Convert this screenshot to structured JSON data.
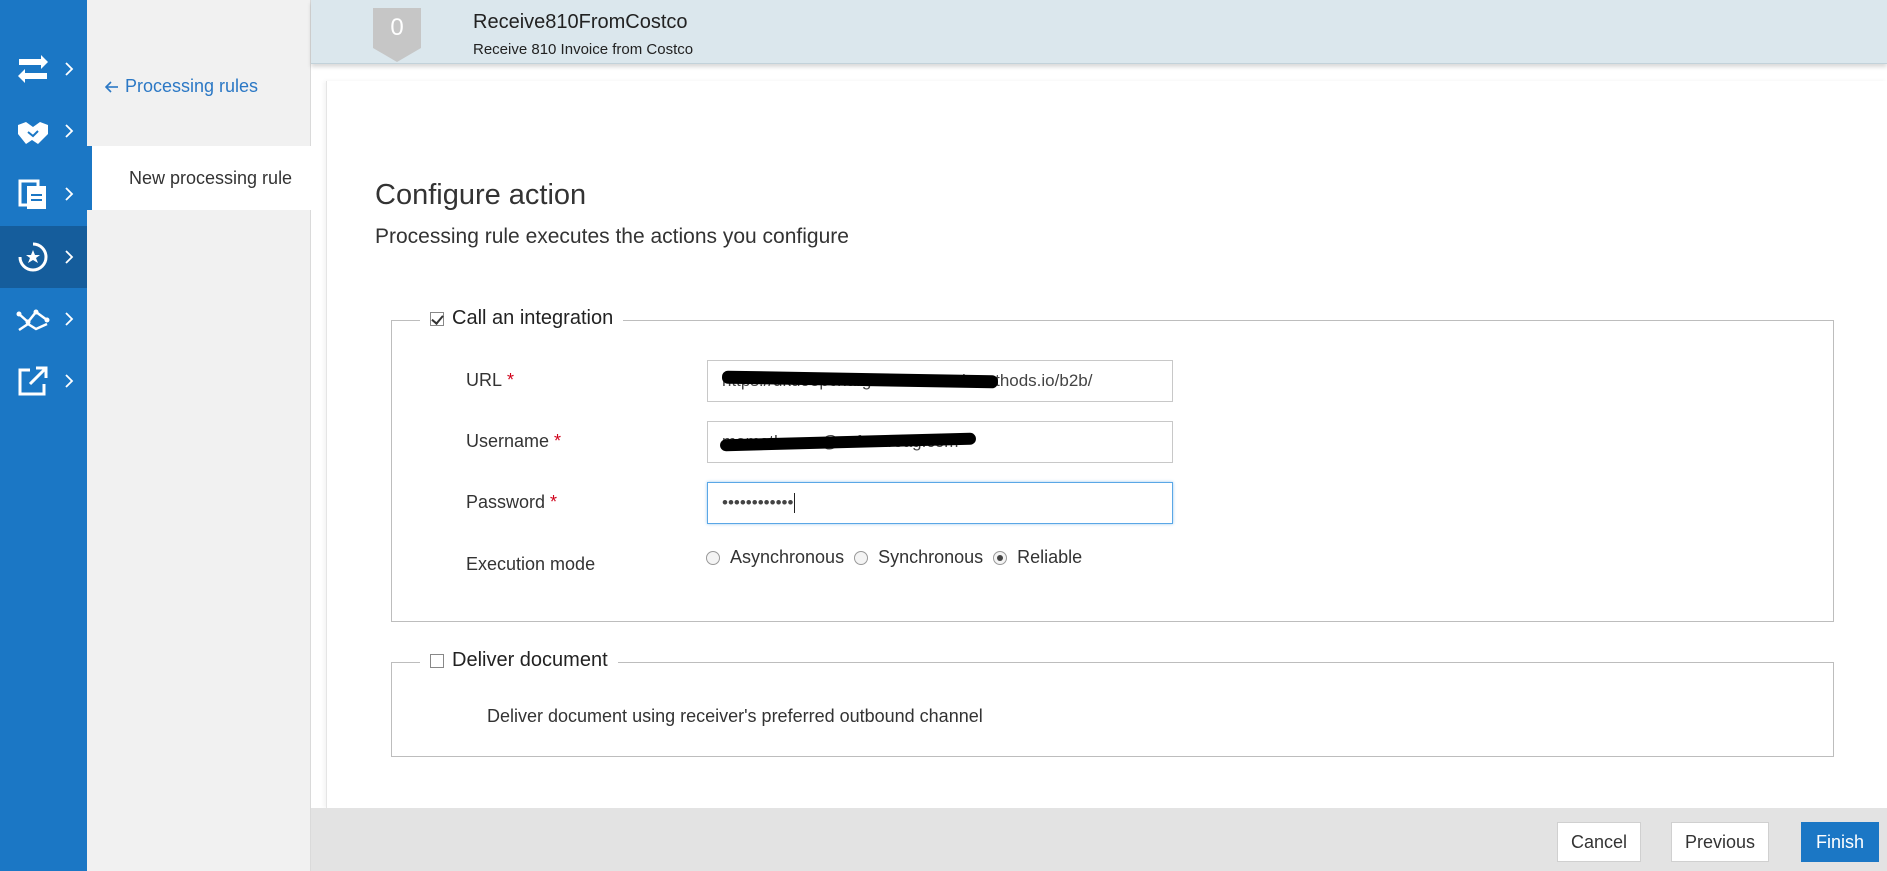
{
  "colors": {
    "rail": "#1b77c5",
    "rail_active": "#155d9c",
    "header_band": "#dbe7ed",
    "accent": "#1b77c5",
    "required": "#d0021b",
    "badge": "#c6c6c6"
  },
  "rail": {
    "items": [
      {
        "icon": "transfer-arrows-icon"
      },
      {
        "icon": "handshake-icon"
      },
      {
        "icon": "documents-icon"
      },
      {
        "icon": "processing-rules-icon",
        "active": true
      },
      {
        "icon": "analytics-graph-icon"
      },
      {
        "icon": "external-link-icon"
      }
    ]
  },
  "sidebar": {
    "back_label": "Processing rules",
    "items": [
      {
        "label": "New processing rule",
        "active": true
      }
    ]
  },
  "header": {
    "step_number": "0",
    "title": "Receive810FromCostco",
    "subtitle": "Receive 810 Invoice from Costco"
  },
  "main": {
    "title": "Configure action",
    "subtitle": "Processing rule executes the actions you configure"
  },
  "integration": {
    "legend": "Call an integration",
    "checked": true,
    "url_label": "URL",
    "url_value": "https://ukdoepchargh.int.....s.webmethods.io/b2b/",
    "username_label": "Username",
    "username_value": "mamatha.am@softwareag.com",
    "password_label": "Password",
    "password_value": "••••••••••••",
    "execution_label": "Execution mode",
    "execution_options": [
      "Asynchronous",
      "Synchronous",
      "Reliable"
    ],
    "execution_selected": "Reliable"
  },
  "deliver": {
    "legend": "Deliver document",
    "checked": false,
    "description": "Deliver document using receiver's preferred outbound channel"
  },
  "footer": {
    "cancel_label": "Cancel",
    "previous_label": "Previous",
    "finish_label": "Finish"
  }
}
